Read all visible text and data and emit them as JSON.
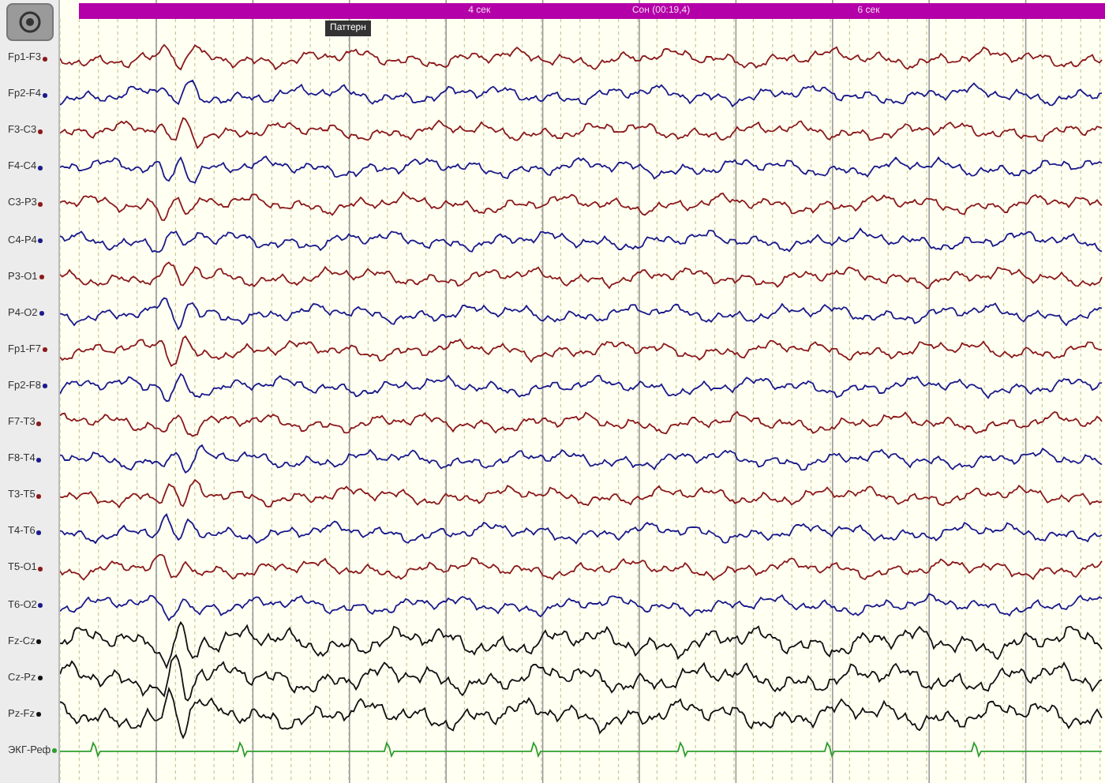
{
  "toolbar": {
    "button": {
      "kind": "target"
    }
  },
  "time_bar": {
    "labels": [
      "4 сек",
      "Сон (00:19,4)",
      "6 сек"
    ]
  },
  "marker": {
    "label": "Паттерн"
  },
  "channels": [
    {
      "label": "Fp1-F3",
      "color": "#8b1a1a"
    },
    {
      "label": "Fp2-F4",
      "color": "#1a1a8b"
    },
    {
      "label": "F3-C3",
      "color": "#8b1a1a"
    },
    {
      "label": "F4-C4",
      "color": "#1a1a8b"
    },
    {
      "label": "C3-P3",
      "color": "#8b1a1a"
    },
    {
      "label": "C4-P4",
      "color": "#1a1a8b"
    },
    {
      "label": "P3-O1",
      "color": "#8b1a1a"
    },
    {
      "label": "P4-O2",
      "color": "#1a1a8b"
    },
    {
      "label": "Fp1-F7",
      "color": "#8b1a1a"
    },
    {
      "label": "Fp2-F8",
      "color": "#1a1a8b"
    },
    {
      "label": "F7-T3",
      "color": "#8b1a1a"
    },
    {
      "label": "F8-T4",
      "color": "#1a1a8b"
    },
    {
      "label": "T3-T5",
      "color": "#8b1a1a"
    },
    {
      "label": "T4-T6",
      "color": "#1a1a8b"
    },
    {
      "label": "T5-O1",
      "color": "#8b1a1a"
    },
    {
      "label": "T6-O2",
      "color": "#1a1a8b"
    },
    {
      "label": "Fz-Cz",
      "color": "#111111"
    },
    {
      "label": "Cz-Pz",
      "color": "#111111"
    },
    {
      "label": "Pz-Fz",
      "color": "#111111"
    },
    {
      "label": "ЭКГ-Реф",
      "color": "#2e9e2e",
      "kind": "ecg"
    }
  ]
}
